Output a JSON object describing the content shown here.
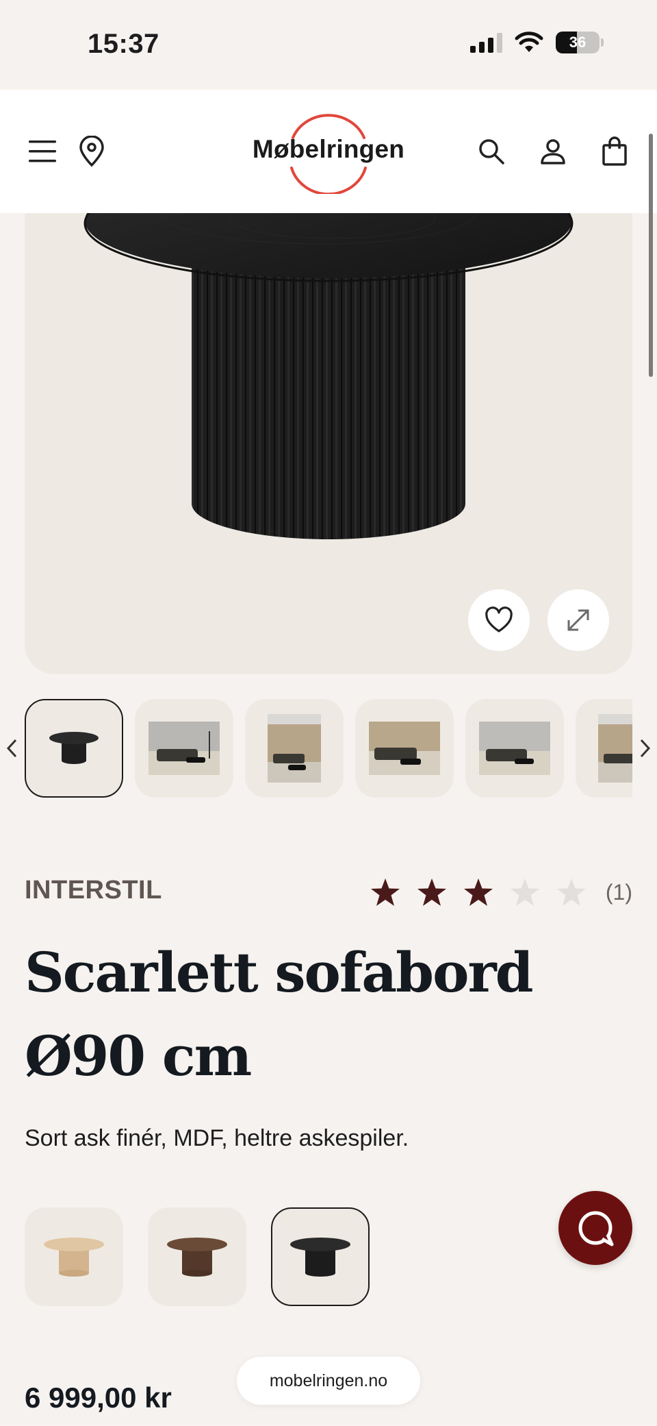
{
  "status_bar": {
    "time": "15:37",
    "battery": "36"
  },
  "header": {
    "logo": "Møbelringen",
    "logo_accent": "#e2463b"
  },
  "gallery": {
    "thumbnail_count": 6,
    "selected_index": 0
  },
  "product": {
    "brand": "INTERSTIL",
    "rating": 3,
    "rating_max": 5,
    "review_count": "(1)",
    "title": "Scarlett sofabord Ø90 cm",
    "description": "Sort ask finér, MDF, heltre askespiler.",
    "price": "6 999,00 kr",
    "variants": [
      {
        "name": "natural-oak",
        "color": "#d9bd98"
      },
      {
        "name": "walnut",
        "color": "#5b4030"
      },
      {
        "name": "black-ash",
        "color": "#1f1f20"
      }
    ],
    "selected_variant": 2
  },
  "colors": {
    "star_filled": "#4a1a1a",
    "star_empty": "#e3dfdc",
    "chat": "#6b1010",
    "background": "#f6f2ef"
  },
  "browser": {
    "url": "mobelringen.no"
  }
}
